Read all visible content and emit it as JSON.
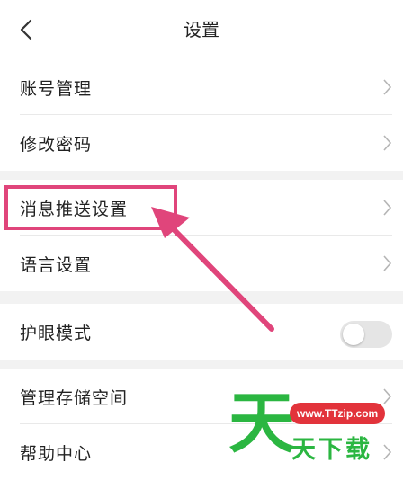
{
  "header": {
    "title": "设置",
    "back_icon": "chevron-left-icon"
  },
  "groups": [
    {
      "items": [
        {
          "label": "账号管理"
        },
        {
          "label": "修改密码"
        }
      ]
    },
    {
      "items": [
        {
          "label": "消息推送设置"
        },
        {
          "label": "语言设置"
        }
      ]
    },
    {
      "items": [
        {
          "label": "护眼模式",
          "toggle": false
        }
      ]
    },
    {
      "items": [
        {
          "label": "管理存储空间"
        },
        {
          "label": "帮助中心"
        }
      ]
    }
  ],
  "annotation": {
    "color": "#e0457b"
  },
  "watermark": {
    "mark": "天",
    "url": "www.TTzip.com",
    "text": "天下载",
    "green": "#2bb641",
    "red": "#e2333b"
  }
}
